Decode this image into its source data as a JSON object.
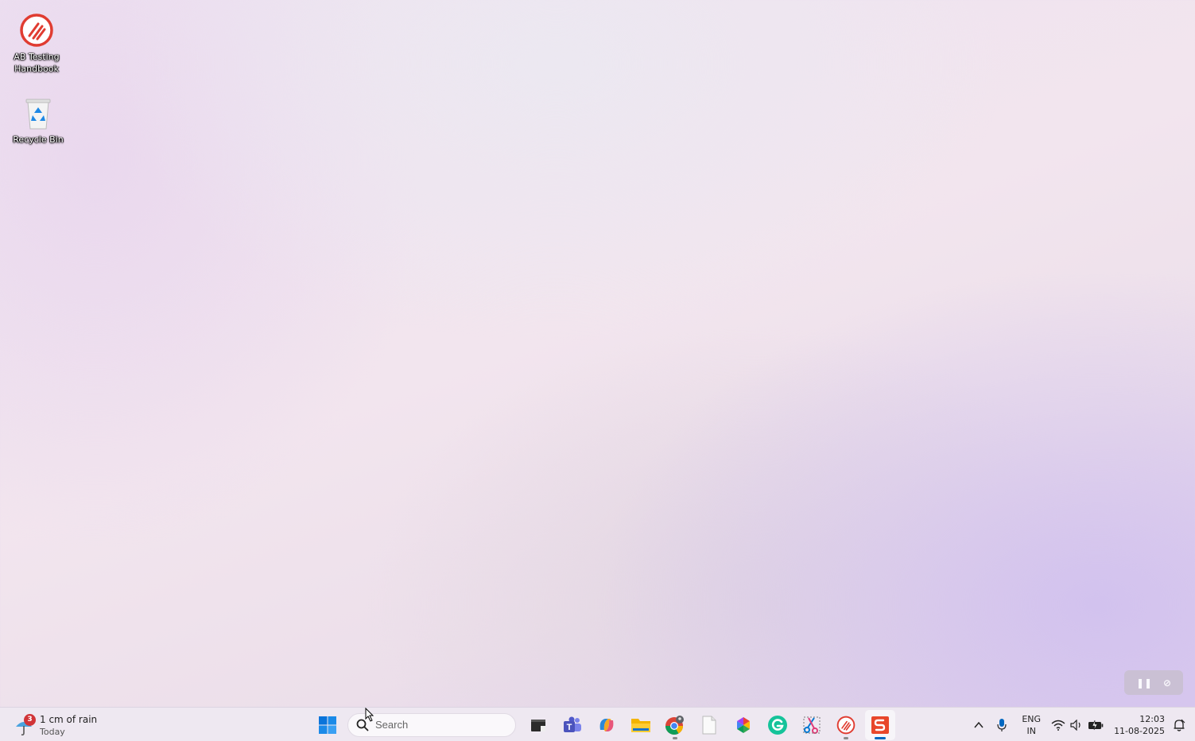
{
  "desktop": {
    "icons": [
      {
        "label": "AB Testing\nHandbook"
      },
      {
        "label": "Recycle Bin"
      }
    ]
  },
  "taskbar": {
    "weather": {
      "badge": "3",
      "main": "1 cm of rain",
      "sub": "Today"
    },
    "search": {
      "placeholder": "Search"
    },
    "apps": [
      {
        "name": "Windows Start"
      },
      {
        "name": "Terminal"
      },
      {
        "name": "Microsoft Teams"
      },
      {
        "name": "Copilot"
      },
      {
        "name": "File Explorer"
      },
      {
        "name": "Google Chrome"
      },
      {
        "name": "Notepad"
      },
      {
        "name": "Photos"
      },
      {
        "name": "Grammarly"
      },
      {
        "name": "Snipping Tool"
      },
      {
        "name": "AB Testing Handbook"
      },
      {
        "name": "Screen Recorder"
      }
    ],
    "tray": {
      "lang_top": "ENG",
      "lang_bottom": "IN",
      "time": "12:03",
      "date": "11-08-2025"
    }
  },
  "colors": {
    "accent": "#0067c0",
    "ab_red": "#e03c31",
    "badge": "#d13438"
  }
}
